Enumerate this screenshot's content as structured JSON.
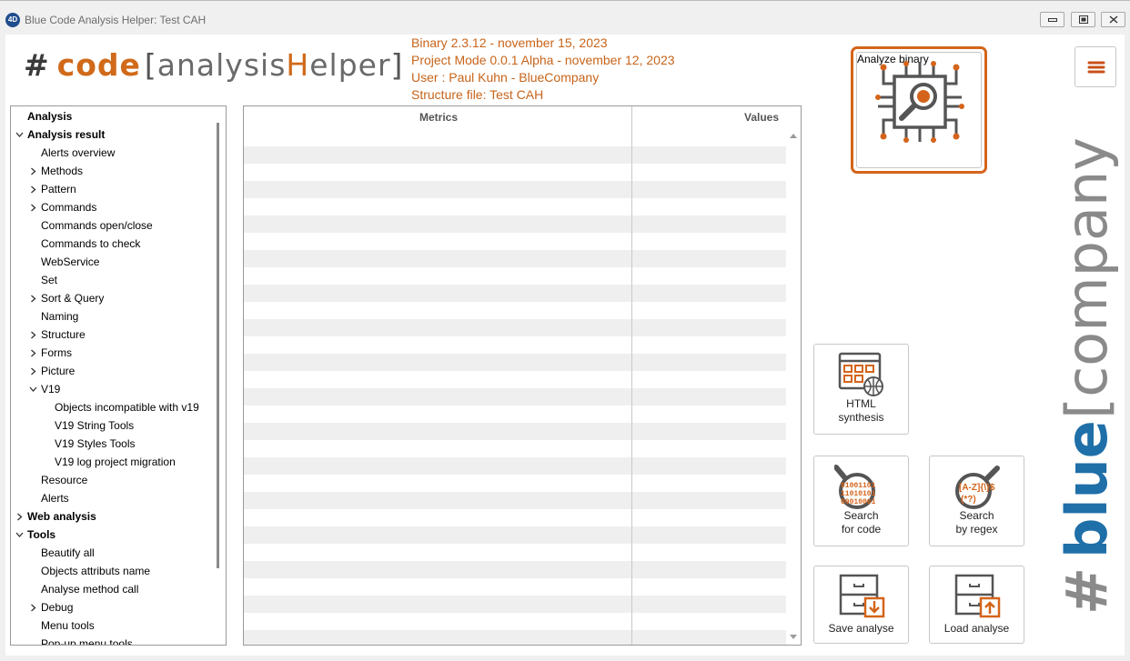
{
  "window": {
    "title": "Blue Code Analysis Helper: Test CAH",
    "app_icon_text": "4D"
  },
  "logo": {
    "hash": "#",
    "word": "code",
    "open_bracket": "[",
    "mid": "analysis",
    "highlight": "H",
    "tail": "elper",
    "close_bracket": "]"
  },
  "info": {
    "binary": "Binary 2.3.12 - november 15, 2023",
    "project_mode": "Project Mode 0.0.1 Alpha - november 12, 2023",
    "user": "User : Paul Kuhn - BlueCompany",
    "structure_file": "Structure file: Test CAH"
  },
  "tree": [
    {
      "label": "Analysis",
      "level": 0,
      "bold": true,
      "toggle": "none"
    },
    {
      "label": "Analysis result",
      "level": 0,
      "bold": true,
      "toggle": "open"
    },
    {
      "label": "Alerts overview",
      "level": 1,
      "bold": false,
      "toggle": "none"
    },
    {
      "label": "Methods",
      "level": 1,
      "bold": false,
      "toggle": "closed"
    },
    {
      "label": "Pattern",
      "level": 1,
      "bold": false,
      "toggle": "closed"
    },
    {
      "label": "Commands",
      "level": 1,
      "bold": false,
      "toggle": "closed"
    },
    {
      "label": "Commands open/close",
      "level": 1,
      "bold": false,
      "toggle": "none"
    },
    {
      "label": "Commands to check",
      "level": 1,
      "bold": false,
      "toggle": "none"
    },
    {
      "label": "WebService",
      "level": 1,
      "bold": false,
      "toggle": "none"
    },
    {
      "label": "Set",
      "level": 1,
      "bold": false,
      "toggle": "none"
    },
    {
      "label": "Sort & Query",
      "level": 1,
      "bold": false,
      "toggle": "closed"
    },
    {
      "label": "Naming",
      "level": 1,
      "bold": false,
      "toggle": "none"
    },
    {
      "label": "Structure",
      "level": 1,
      "bold": false,
      "toggle": "closed"
    },
    {
      "label": "Forms",
      "level": 1,
      "bold": false,
      "toggle": "closed"
    },
    {
      "label": "Picture",
      "level": 1,
      "bold": false,
      "toggle": "closed"
    },
    {
      "label": "V19",
      "level": 1,
      "bold": false,
      "toggle": "open"
    },
    {
      "label": "Objects incompatible with v19",
      "level": 2,
      "bold": false,
      "toggle": "none"
    },
    {
      "label": "V19 String Tools",
      "level": 2,
      "bold": false,
      "toggle": "none"
    },
    {
      "label": "V19 Styles Tools",
      "level": 2,
      "bold": false,
      "toggle": "none"
    },
    {
      "label": "V19 log project migration",
      "level": 2,
      "bold": false,
      "toggle": "none"
    },
    {
      "label": "Resource",
      "level": 1,
      "bold": false,
      "toggle": "none"
    },
    {
      "label": "Alerts",
      "level": 1,
      "bold": false,
      "toggle": "none"
    },
    {
      "label": "Web analysis",
      "level": 0,
      "bold": true,
      "toggle": "closed"
    },
    {
      "label": "Tools",
      "level": 0,
      "bold": true,
      "toggle": "open"
    },
    {
      "label": "Beautify all",
      "level": 1,
      "bold": false,
      "toggle": "none"
    },
    {
      "label": "Objects attributs name",
      "level": 1,
      "bold": false,
      "toggle": "none"
    },
    {
      "label": "Analyse method call",
      "level": 1,
      "bold": false,
      "toggle": "none"
    },
    {
      "label": "Debug",
      "level": 1,
      "bold": false,
      "toggle": "closed"
    },
    {
      "label": "Menu tools",
      "level": 1,
      "bold": false,
      "toggle": "none"
    },
    {
      "label": "Pop-up menu tools",
      "level": 1,
      "bold": false,
      "toggle": "none"
    }
  ],
  "grid": {
    "col_metrics": "Metrics",
    "col_values": "Values"
  },
  "buttons": {
    "analyze": "Analyze binary",
    "html_line1": "HTML",
    "html_line2": "synthesis",
    "search_code_line1": "Search",
    "search_code_line2": "for code",
    "search_regex_line1": "Search",
    "search_regex_line2": "by regex",
    "save": "Save analyse",
    "load": "Load analyse"
  },
  "icon_text": {
    "binary_digits": [
      "01001101",
      "11010101",
      "00010001"
    ],
    "regex_top": "[A-Z]{\\}$",
    "regex_bottom": "(*?)"
  },
  "side_logo": {
    "hash": "#",
    "word": "blue",
    "rest": "[company]"
  },
  "colors": {
    "accent": "#d4641a",
    "brand_blue": "#1f6fa8",
    "gray_logo": "#8a8a8a"
  },
  "icons": [
    "app-4d-icon",
    "minimize-icon",
    "maximize-icon",
    "close-icon",
    "hamburger-menu-icon",
    "circuit-magnifier-icon",
    "html-window-icon",
    "code-search-icon",
    "regex-search-icon",
    "save-drawer-icon",
    "load-drawer-icon",
    "expand-chevron-icon",
    "collapse-chevron-icon"
  ]
}
